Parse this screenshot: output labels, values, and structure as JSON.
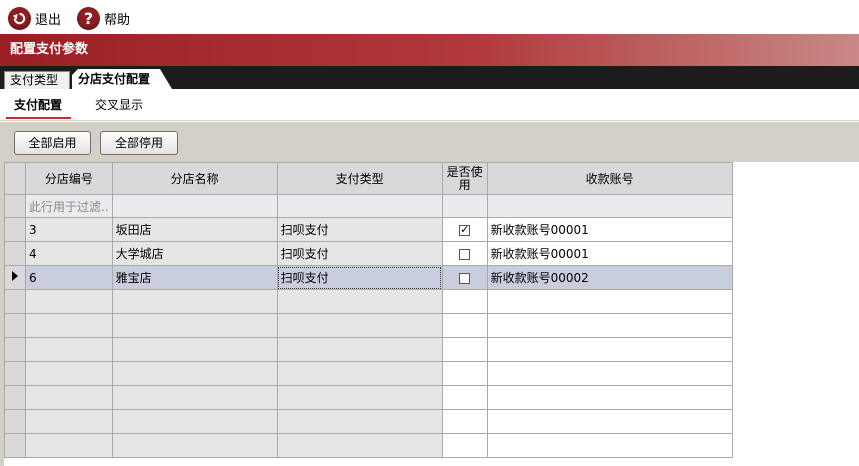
{
  "toolbar": {
    "exit_label": "退出",
    "help_label": "帮助",
    "exit_icon": "back-arrow-icon",
    "help_icon": "question-icon"
  },
  "title": "配置支付参数",
  "tabs": [
    "支付类型",
    "分店支付配置"
  ],
  "active_tab": "分店支付配置",
  "subtabs": [
    "支付配置",
    "交叉显示"
  ],
  "active_subtab": "支付配置",
  "buttons": {
    "enable_all": "全部启用",
    "disable_all": "全部停用"
  },
  "grid": {
    "columns": [
      "分店编号",
      "分店名称",
      "支付类型",
      "是否使用",
      "收款账号"
    ],
    "filter_placeholder": "此行用于过滤..",
    "rows": [
      {
        "id": "3",
        "name": "坂田店",
        "type": "扫呗支付",
        "enabled": true,
        "account": "新收款账号00001"
      },
      {
        "id": "4",
        "name": "大学城店",
        "type": "扫呗支付",
        "enabled": false,
        "account": "新收款账号00001"
      },
      {
        "id": "6",
        "name": "雅宝店",
        "type": "扫呗支付",
        "enabled": false,
        "account": "新收款账号00002",
        "selected": true
      }
    ]
  },
  "colors": {
    "accent": "#9a1f24",
    "header_bg": "#d9d9dc",
    "selected_row": "#c8cede"
  }
}
